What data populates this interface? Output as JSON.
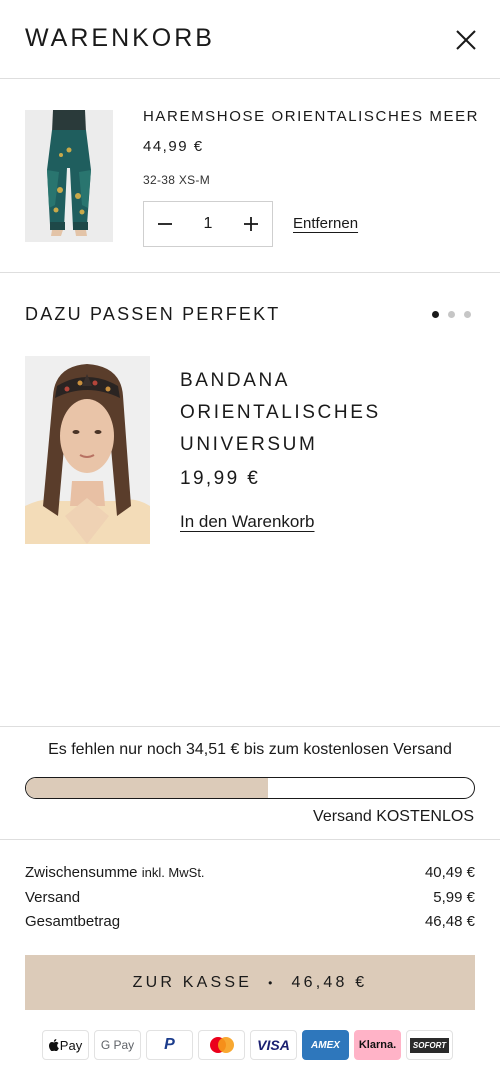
{
  "header": {
    "title": "WARENKORB"
  },
  "cart_item": {
    "name": "HAREMSHOSE ORIENTALISCHES MEER",
    "price": "44,99 €",
    "variant": "32-38 XS-M",
    "quantity": "1",
    "remove_label": "Entfernen"
  },
  "upsell": {
    "title": "DAZU PASSEN PERFEKT",
    "product_name": "BANDANA ORIENTALISCHES UNIVERSUM",
    "product_price": "19,99 €",
    "add_label": "In den Warenkorb",
    "carousel_pages": 3,
    "carousel_active": 1
  },
  "shipping": {
    "message": "Es fehlen nur noch 34,51 € bis zum kostenlosen Versand",
    "progress_fraction": 0.54,
    "free_label": "Versand KOSTENLOS",
    "progress_color": "#dccbb9"
  },
  "totals": {
    "subtotal_label": "Zwischensumme",
    "subtotal_note": "inkl. MwSt.",
    "subtotal_value": "40,49 €",
    "shipping_label": "Versand",
    "shipping_value": "5,99 €",
    "total_label": "Gesamtbetrag",
    "total_value": "46,48 €"
  },
  "checkout": {
    "label": "ZUR KASSE",
    "separator": "•",
    "amount": "46,48 €",
    "color": "#dccbb9"
  },
  "payments": [
    {
      "label": "Pay",
      "icon": "apple-pay-icon"
    },
    {
      "label": "G Pay",
      "icon": "google-pay-icon"
    },
    {
      "label": "P",
      "icon": "paypal-icon"
    },
    {
      "label": "",
      "icon": "mastercard-icon"
    },
    {
      "label": "VISA",
      "icon": "visa-icon"
    },
    {
      "label": "AMEX",
      "icon": "amex-icon"
    },
    {
      "label": "Klarna.",
      "icon": "klarna-icon"
    },
    {
      "label": "SOFORT",
      "icon": "sofort-icon"
    }
  ]
}
